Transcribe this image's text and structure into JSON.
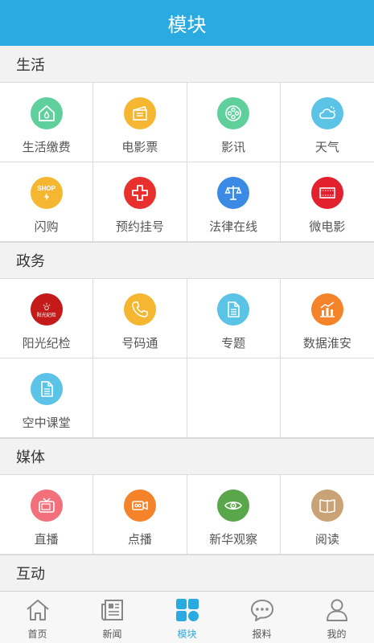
{
  "header": {
    "title": "模块"
  },
  "sections": {
    "life": {
      "title": "生活",
      "items": [
        {
          "label": "生活缴费",
          "icon": "home-drop-icon",
          "color": "#5fcf9b"
        },
        {
          "label": "电影票",
          "icon": "ticket-icon",
          "color": "#f5b731"
        },
        {
          "label": "影讯",
          "icon": "film-reel-icon",
          "color": "#5fcf9b"
        },
        {
          "label": "天气",
          "icon": "cloud-sun-icon",
          "color": "#5bc3e6"
        },
        {
          "label": "闪购",
          "icon": "shop-icon",
          "color": "#f5b731",
          "badge": "SHOP"
        },
        {
          "label": "预约挂号",
          "icon": "medical-cross-icon",
          "color": "#e8312f"
        },
        {
          "label": "法律在线",
          "icon": "scales-icon",
          "color": "#3b8be6"
        },
        {
          "label": "微电影",
          "icon": "film-strip-icon",
          "color": "#e3202d"
        }
      ]
    },
    "gov": {
      "title": "政务",
      "items": [
        {
          "label": "阳光纪检",
          "icon": "sunshine-logo-icon",
          "color": "#c41a1a",
          "logo_text": "阳光纪检"
        },
        {
          "label": "号码通",
          "icon": "phone-icon",
          "color": "#f5b731"
        },
        {
          "label": "专题",
          "icon": "document-icon",
          "color": "#5bc3e6"
        },
        {
          "label": "数据淮安",
          "icon": "bar-chart-icon",
          "color": "#f5832a"
        },
        {
          "label": "空中课堂",
          "icon": "document-icon",
          "color": "#5bc3e6"
        }
      ]
    },
    "media": {
      "title": "媒体",
      "items": [
        {
          "label": "直播",
          "icon": "tv-icon",
          "color": "#f2707c"
        },
        {
          "label": "点播",
          "icon": "video-camera-icon",
          "color": "#f5832a"
        },
        {
          "label": "新华观察",
          "icon": "eye-icon",
          "color": "#5aa64a"
        },
        {
          "label": "阅读",
          "icon": "book-icon",
          "color": "#c9a276"
        }
      ]
    },
    "interact": {
      "title": "互动"
    }
  },
  "tabbar": {
    "active": "modules",
    "items": [
      {
        "label": "首页",
        "icon": "home-icon"
      },
      {
        "label": "新闻",
        "icon": "newspaper-icon"
      },
      {
        "label": "模块",
        "icon": "grid-icon"
      },
      {
        "label": "报料",
        "icon": "chat-bubble-icon"
      },
      {
        "label": "我的",
        "icon": "user-icon"
      }
    ],
    "active_color": "#29abe2",
    "inactive_color": "#888888"
  }
}
